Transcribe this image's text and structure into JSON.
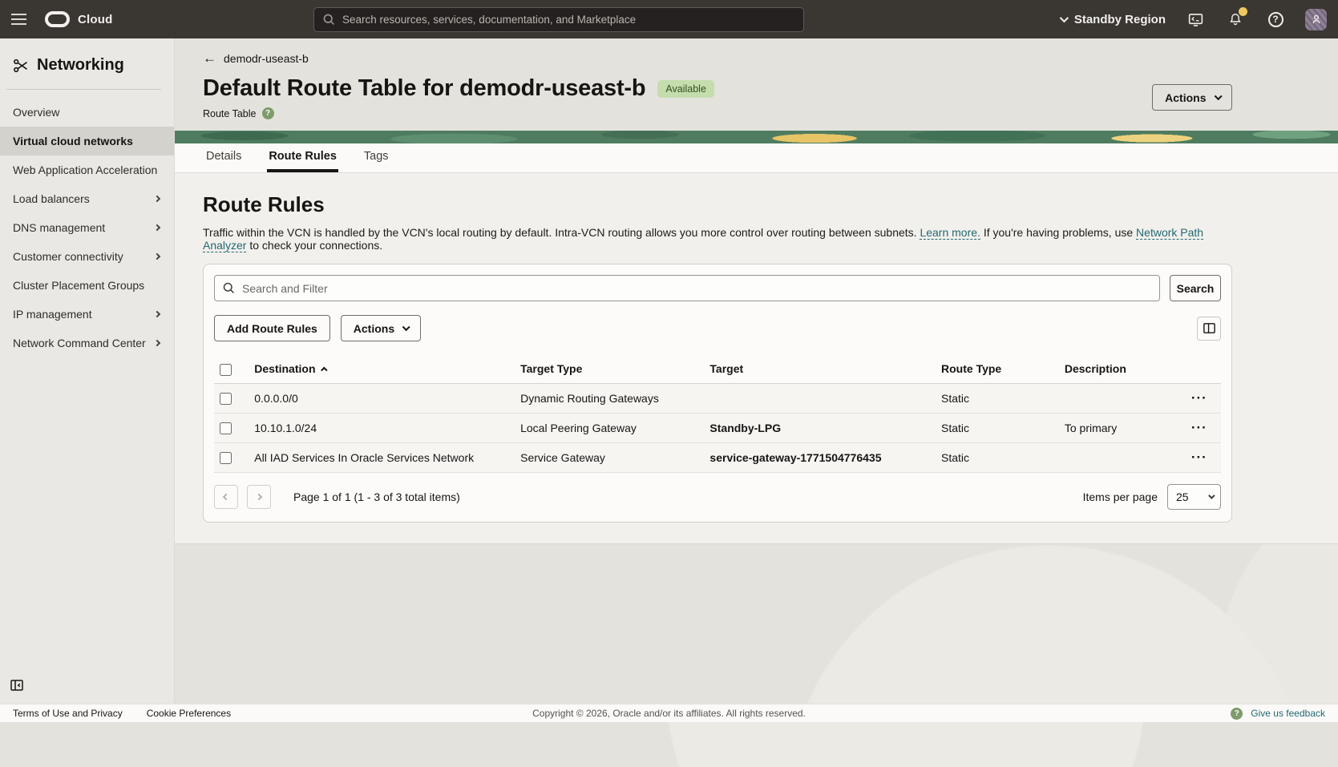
{
  "topbar": {
    "brand": "Cloud",
    "search_placeholder": "Search resources, services, documentation, and Marketplace",
    "region_label": "Standby Region"
  },
  "sidebar": {
    "title": "Networking",
    "items": [
      {
        "label": "Overview"
      },
      {
        "label": "Virtual cloud networks",
        "selected": true
      },
      {
        "label": "Web Application Acceleration"
      },
      {
        "label": "Load balancers",
        "expandable": true
      },
      {
        "label": "DNS management",
        "expandable": true
      },
      {
        "label": "Customer connectivity",
        "expandable": true
      },
      {
        "label": "Cluster Placement Groups"
      },
      {
        "label": "IP management",
        "expandable": true
      },
      {
        "label": "Network Command Center",
        "expandable": true
      }
    ]
  },
  "header": {
    "breadcrumb": "demodr-useast-b",
    "title": "Default Route Table for demodr-useast-b",
    "status_badge": "Available",
    "resource_type": "Route Table",
    "actions_label": "Actions"
  },
  "tabs": [
    {
      "label": "Details"
    },
    {
      "label": "Route Rules",
      "active": true
    },
    {
      "label": "Tags"
    }
  ],
  "route_rules": {
    "heading": "Route Rules",
    "description_1": "Traffic within the VCN is handled by the VCN's local routing by default. Intra-VCN routing allows you more control over routing between subnets. ",
    "learn_more_link": "Learn more.",
    "description_2": " If you're having problems, use ",
    "analyzer_link": "Network Path Analyzer",
    "description_3": " to check your connections.",
    "filter_placeholder": "Search and Filter",
    "search_button": "Search",
    "add_button": "Add Route Rules",
    "actions_button": "Actions"
  },
  "table": {
    "columns": [
      "Destination",
      "Target Type",
      "Target",
      "Route Type",
      "Description"
    ],
    "rows": [
      {
        "destination": "0.0.0.0/0",
        "target_type": "Dynamic Routing Gateways",
        "target": "",
        "route_type": "Static",
        "description": ""
      },
      {
        "destination": "10.10.1.0/24",
        "target_type": "Local Peering Gateway",
        "target": "Standby-LPG",
        "route_type": "Static",
        "description": "To primary"
      },
      {
        "destination": "All IAD Services In Oracle Services Network",
        "target_type": "Service Gateway",
        "target": "service-gateway-1771504776435",
        "route_type": "Static",
        "description": ""
      }
    ]
  },
  "pagination": {
    "label": "Page 1 of 1 (1 - 3 of 3 total items)",
    "items_per_page_label": "Items per page",
    "items_per_page_value": "25"
  },
  "footer": {
    "terms": "Terms of Use and Privacy",
    "cookies": "Cookie Preferences",
    "copyright": "Copyright © 2026, Oracle and/or its affiliates. All rights reserved.",
    "feedback": "Give us feedback"
  },
  "icons": {
    "back_arrow": "←",
    "row_actions": "···",
    "help_glyph": "?"
  },
  "colors": {
    "topbar_bg": "#3a3631",
    "banner_green": "#4f7c60",
    "badge_bg": "#c5ddad",
    "badge_text": "#33511f",
    "link_teal": "#226973",
    "avatar_purple": "#8d8098",
    "notification_yellow": "#edc95f"
  }
}
